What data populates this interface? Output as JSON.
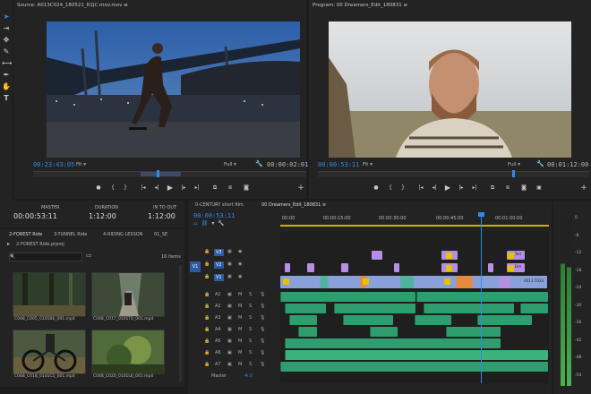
{
  "source_monitor": {
    "title": "Source: A013C024_180521_R1JC.mov.mov",
    "timecode": "00:23:43:05",
    "fit": "Fit",
    "quality": "Full",
    "duration": "00:00:02:01"
  },
  "program_monitor": {
    "title": "Program: 00 Dreamers_Edit_180831",
    "timecode": "00:00:53:11",
    "fit": "Fit",
    "quality": "Full",
    "duration": "00:01:12:00"
  },
  "info_panel": {
    "master_label": "MASTER",
    "master_value": "00:00:53:11",
    "duration_label": "DURATION",
    "duration_value": "1:12:00",
    "inout_label": "IN TO OUT",
    "inout_value": "1:12:00"
  },
  "project": {
    "tabs": [
      "2-FOREST Ride",
      "3-TUNNEL Ride",
      "4-RIDING LESSON",
      "01_SE"
    ],
    "path": "2-FOREST Ride.prproj",
    "count": "16 items",
    "thumbs": [
      "C048_C005_0101B0_001.mp4",
      "C048_C017_0101T0_001.mp4",
      "C048_C018_0101C5_001.mp4",
      "C048_C020_0101L6_001.mp4"
    ]
  },
  "timeline": {
    "tabs": [
      "0-CENTURY short film",
      "00 Dreamers_Edit_180831"
    ],
    "timecode": "00:00:53:11",
    "ruler": [
      "00:00",
      "00:00:15:00",
      "00:00:30:00",
      "00:00:45:00",
      "00:01:00:00"
    ],
    "video_tracks": [
      "V3",
      "V2",
      "V1"
    ],
    "audio_tracks": [
      "A1",
      "A2",
      "A3",
      "A4",
      "A5",
      "A6",
      "A7"
    ],
    "source_patch": "V1",
    "master_label": "Master",
    "master_value": "-4.0",
    "clip_labels": [
      "Tod",
      "Dre",
      "A013 C024"
    ]
  },
  "meter": {
    "scale": [
      "0",
      "-6",
      "-12",
      "-18",
      "-24",
      "-30",
      "-36",
      "-42",
      "-48",
      "-54"
    ]
  },
  "colors": {
    "accent": "#2d8ceb",
    "video_clip": "#8a9fd6",
    "audio_clip": "#2f9e6e",
    "title_clip": "#b58ee6",
    "playhead": "#2d8ceb"
  }
}
